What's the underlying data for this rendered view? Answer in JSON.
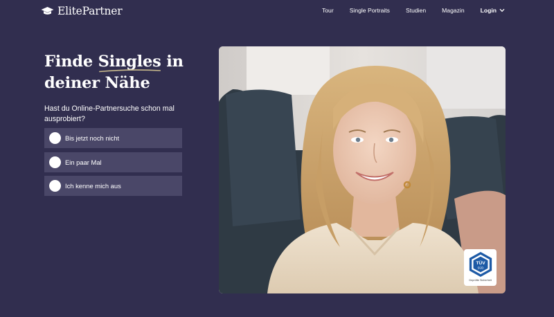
{
  "brand": {
    "name": "ElitePartner",
    "logo_icon": "graduation-cap-icon"
  },
  "nav": {
    "items": [
      {
        "label": "Tour"
      },
      {
        "label": "Single Portraits"
      },
      {
        "label": "Studien"
      },
      {
        "label": "Magazin"
      }
    ],
    "login_label": "Login",
    "login_icon": "chevron-down-icon"
  },
  "hero": {
    "headline_part1": "Finde ",
    "headline_highlight": "Singles",
    "headline_part2": " in deiner Nähe",
    "highlight_color": "#c8b98c",
    "question": "Hast du Online-Partnersuche schon mal ausprobiert?",
    "options": [
      {
        "label": "Bis jetzt noch nicht"
      },
      {
        "label": "Ein paar Mal"
      },
      {
        "label": "Ich kenne mich aus"
      }
    ]
  },
  "badge": {
    "mark": "TÜV",
    "code": "SÜD",
    "caption": "Geprüfte Sicherheit"
  },
  "colors": {
    "background": "#312e4f",
    "option_bg": "#4a4768",
    "text": "#ffffff"
  }
}
